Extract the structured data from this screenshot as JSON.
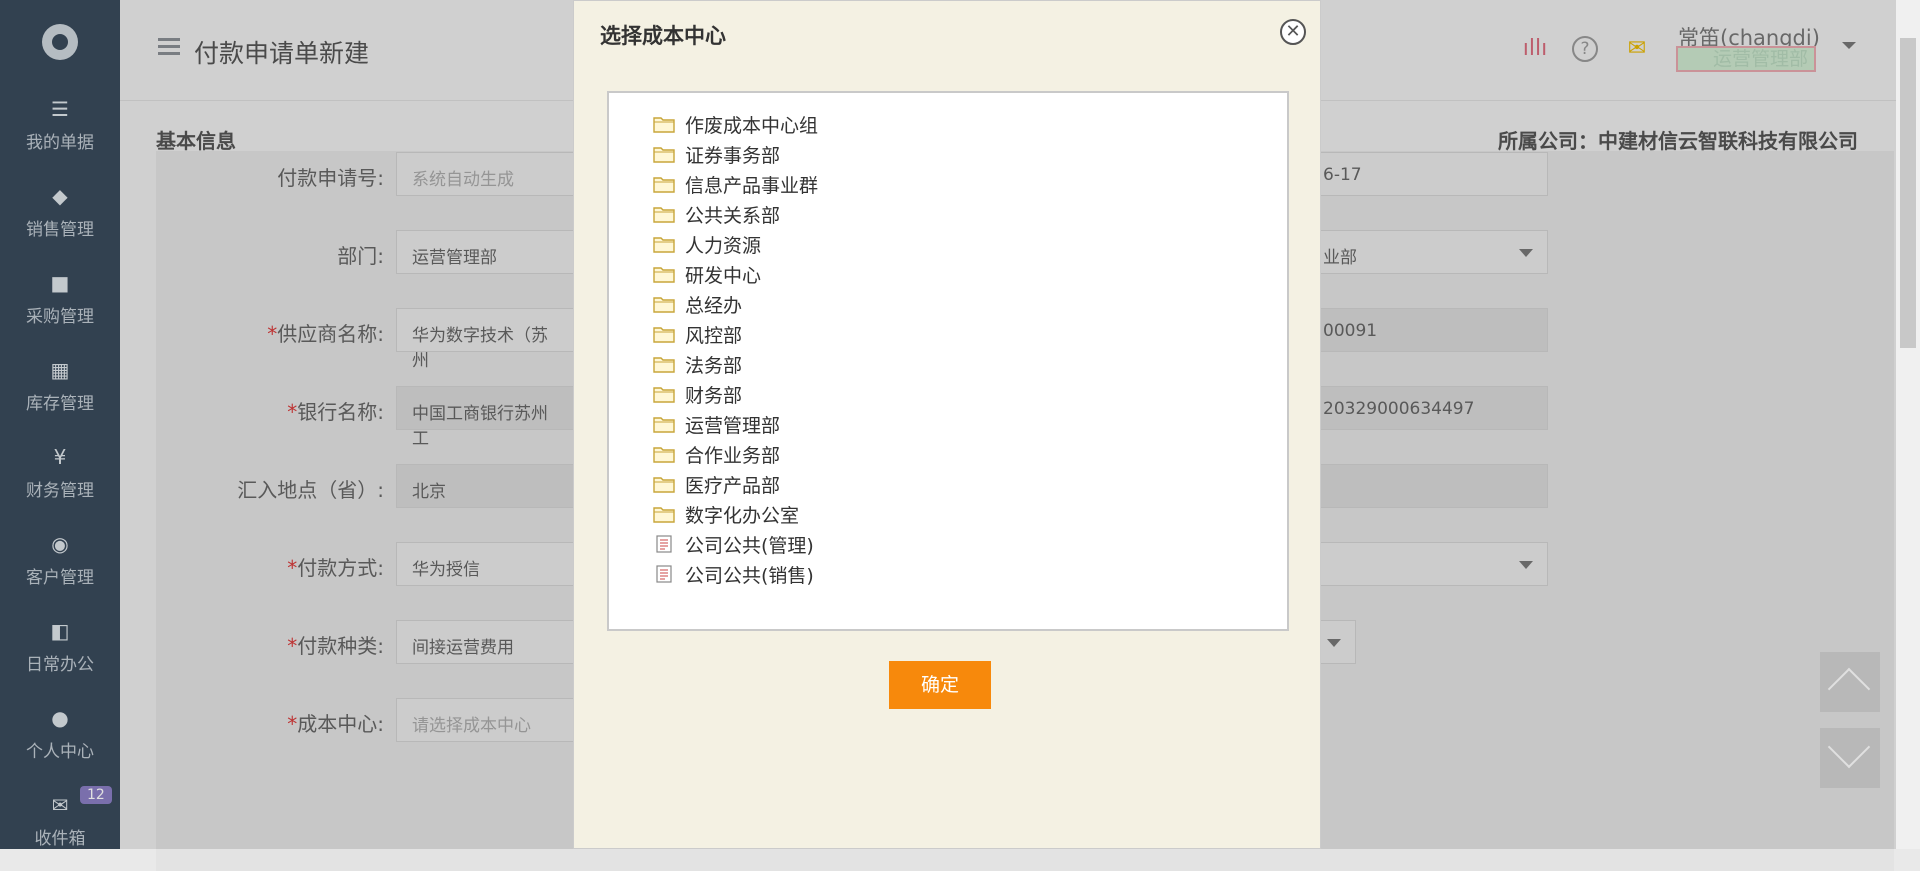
{
  "sidebar": {
    "items": [
      {
        "icon": "documents-icon",
        "glyph": "☰",
        "label": "我的单据"
      },
      {
        "icon": "tag-icon",
        "glyph": "◆",
        "label": "销售管理"
      },
      {
        "icon": "truck-icon",
        "glyph": "■",
        "label": "采购管理"
      },
      {
        "icon": "grid-icon",
        "glyph": "▦",
        "label": "库存管理"
      },
      {
        "icon": "yen-icon",
        "glyph": "¥",
        "label": "财务管理"
      },
      {
        "icon": "target-icon",
        "glyph": "◉",
        "label": "客户管理"
      },
      {
        "icon": "office-icon",
        "glyph": "◧",
        "label": "日常办公"
      },
      {
        "icon": "user-icon",
        "glyph": "●",
        "label": "个人中心"
      },
      {
        "icon": "envelope-icon",
        "glyph": "✉",
        "label": "收件箱",
        "badge": "12"
      }
    ]
  },
  "header": {
    "title": "付款申请单新建",
    "user_name": "常笛(changdi)",
    "user_dept": "运营管理部"
  },
  "content": {
    "section_title": "基本信息",
    "company": "所属公司：中建材信云智联科技有限公司",
    "rows": [
      {
        "label": "付款申请号:",
        "required": false,
        "value": "系统自动生成",
        "placeholder": true,
        "grey": false,
        "right_value": "6-17",
        "right_grey": false,
        "right_caret": false
      },
      {
        "label": "部门:",
        "required": false,
        "value": "运营管理部",
        "placeholder": false,
        "grey": false,
        "right_value": "业部",
        "right_grey": false,
        "right_caret": true
      },
      {
        "label": "供应商名称:",
        "required": true,
        "value": "华为数字技术（苏州",
        "placeholder": false,
        "grey": false,
        "right_value": "00091",
        "right_grey": true,
        "right_caret": false
      },
      {
        "label": "银行名称:",
        "required": true,
        "value": "中国工商银行苏州工",
        "placeholder": false,
        "grey": true,
        "right_value": "20329000634497",
        "right_grey": true,
        "right_caret": false
      },
      {
        "label": "汇入地点（省）:",
        "required": false,
        "value": "北京",
        "placeholder": false,
        "grey": true,
        "right_value": "",
        "right_grey": true,
        "right_caret": false
      },
      {
        "label": "付款方式:",
        "required": true,
        "value": "华为授信",
        "placeholder": false,
        "grey": false,
        "right_value": "",
        "right_grey": false,
        "right_caret": true
      },
      {
        "label": "付款种类:",
        "required": true,
        "value": "间接运营费用",
        "placeholder": false,
        "grey": false,
        "right_value": "",
        "right_grey": false,
        "right_caret": false
      },
      {
        "label": "成本中心:",
        "required": true,
        "value": "请选择成本中心",
        "placeholder": true,
        "grey": false,
        "right_value": "",
        "right_grey": false,
        "right_caret": false
      }
    ]
  },
  "modal": {
    "title": "选择成本中心",
    "close_icon": "close-icon",
    "ok_label": "确定",
    "items": [
      {
        "label": "作废成本中心组",
        "type": "folder"
      },
      {
        "label": "证券事务部",
        "type": "folder"
      },
      {
        "label": "信息产品事业群",
        "type": "folder"
      },
      {
        "label": "公共关系部",
        "type": "folder"
      },
      {
        "label": "人力资源",
        "type": "folder"
      },
      {
        "label": "研发中心",
        "type": "folder"
      },
      {
        "label": "总经办",
        "type": "folder"
      },
      {
        "label": "风控部",
        "type": "folder"
      },
      {
        "label": "法务部",
        "type": "folder"
      },
      {
        "label": "财务部",
        "type": "folder"
      },
      {
        "label": "运营管理部",
        "type": "folder"
      },
      {
        "label": "合作业务部",
        "type": "folder"
      },
      {
        "label": "医疗产品部",
        "type": "folder"
      },
      {
        "label": "数字化办公室",
        "type": "folder"
      },
      {
        "label": "公司公共(管理)",
        "type": "file"
      },
      {
        "label": "公司公共(销售)",
        "type": "file"
      }
    ]
  },
  "colors": {
    "sidebar_bg": "#3a4a5c",
    "modal_bg": "#f4f1e3",
    "ok_button": "#f7890c",
    "required_mark": "#d83b3b",
    "badge": "#8b7fc4"
  }
}
